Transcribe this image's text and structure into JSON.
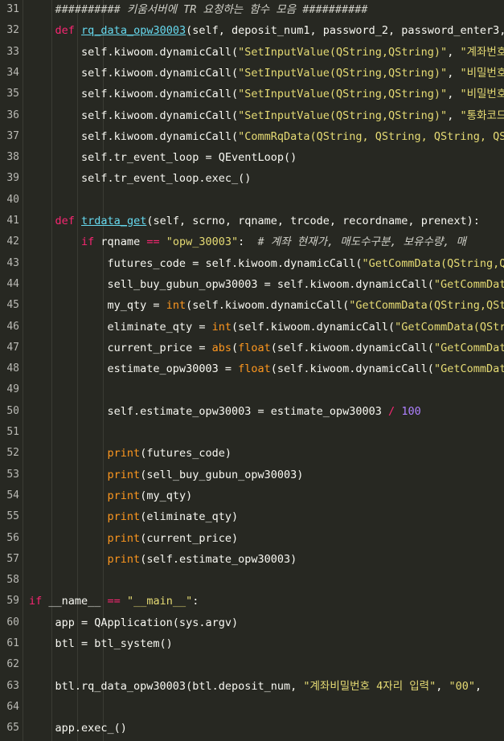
{
  "editor": {
    "lines": [
      {
        "num": "31",
        "tokens": [
          {
            "t": "    "
          },
          {
            "t": "########## 키움서버에 TR 요청하는 함수 모음 ##########",
            "c": "cm"
          }
        ]
      },
      {
        "num": "32",
        "tokens": [
          {
            "t": "    "
          },
          {
            "t": "def",
            "c": "kw"
          },
          {
            "t": " "
          },
          {
            "t": "rq_data_opw30003",
            "c": "fn"
          },
          {
            "t": "(self, deposit_num1, password_2, password_enter3, "
          }
        ]
      },
      {
        "num": "33",
        "tokens": [
          {
            "t": "        self.kiwoom.dynamicCall("
          },
          {
            "t": "\"SetInputValue(QString,QString)\"",
            "c": "str"
          },
          {
            "t": ", "
          },
          {
            "t": "\"계좌번호",
            "c": "str"
          }
        ]
      },
      {
        "num": "34",
        "tokens": [
          {
            "t": "        self.kiwoom.dynamicCall("
          },
          {
            "t": "\"SetInputValue(QString,QString)\"",
            "c": "str"
          },
          {
            "t": ", "
          },
          {
            "t": "\"비밀번호",
            "c": "str"
          }
        ]
      },
      {
        "num": "35",
        "tokens": [
          {
            "t": "        self.kiwoom.dynamicCall("
          },
          {
            "t": "\"SetInputValue(QString,QString)\"",
            "c": "str"
          },
          {
            "t": ", "
          },
          {
            "t": "\"비밀번호",
            "c": "str"
          }
        ]
      },
      {
        "num": "36",
        "tokens": [
          {
            "t": "        self.kiwoom.dynamicCall("
          },
          {
            "t": "\"SetInputValue(QString,QString)\"",
            "c": "str"
          },
          {
            "t": ", "
          },
          {
            "t": "\"통화코드",
            "c": "str"
          }
        ]
      },
      {
        "num": "37",
        "tokens": [
          {
            "t": "        self.kiwoom.dynamicCall("
          },
          {
            "t": "\"CommRqData(QString, QString, QString, QSt",
            "c": "str"
          }
        ]
      },
      {
        "num": "38",
        "tokens": [
          {
            "t": "        self.tr_event_loop = QEventLoop()"
          }
        ]
      },
      {
        "num": "39",
        "tokens": [
          {
            "t": "        self.tr_event_loop.exec_()"
          }
        ]
      },
      {
        "num": "40",
        "tokens": []
      },
      {
        "num": "41",
        "tokens": [
          {
            "t": "    "
          },
          {
            "t": "def",
            "c": "kw"
          },
          {
            "t": " "
          },
          {
            "t": "trdata_get",
            "c": "fn"
          },
          {
            "t": "(self, scrno, rqname, trcode, recordname, prenext):"
          }
        ]
      },
      {
        "num": "42",
        "tokens": [
          {
            "t": "        "
          },
          {
            "t": "if",
            "c": "kw"
          },
          {
            "t": " rqname "
          },
          {
            "t": "==",
            "c": "kw"
          },
          {
            "t": " "
          },
          {
            "t": "\"opw_30003\"",
            "c": "str"
          },
          {
            "t": ":  "
          },
          {
            "t": "# 계좌 현재가, 매도수구분, 보유수량, 매",
            "c": "cm"
          }
        ]
      },
      {
        "num": "43",
        "tokens": [
          {
            "t": "            futures_code = self.kiwoom.dynamicCall("
          },
          {
            "t": "\"GetCommData(QString,QS",
            "c": "str"
          }
        ]
      },
      {
        "num": "44",
        "tokens": [
          {
            "t": "            sell_buy_gubun_opw30003 = self.kiwoom.dynamicCall("
          },
          {
            "t": "\"GetCommData",
            "c": "str"
          }
        ]
      },
      {
        "num": "45",
        "tokens": [
          {
            "t": "            my_qty = "
          },
          {
            "t": "int",
            "c": "bi"
          },
          {
            "t": "(self.kiwoom.dynamicCall("
          },
          {
            "t": "\"GetCommData(QString,QStr",
            "c": "str"
          }
        ]
      },
      {
        "num": "46",
        "tokens": [
          {
            "t": "            eliminate_qty = "
          },
          {
            "t": "int",
            "c": "bi"
          },
          {
            "t": "(self.kiwoom.dynamicCall("
          },
          {
            "t": "\"GetCommData(QStri",
            "c": "str"
          }
        ]
      },
      {
        "num": "47",
        "tokens": [
          {
            "t": "            current_price = "
          },
          {
            "t": "abs",
            "c": "bi"
          },
          {
            "t": "("
          },
          {
            "t": "float",
            "c": "bi"
          },
          {
            "t": "(self.kiwoom.dynamicCall("
          },
          {
            "t": "\"GetCommData",
            "c": "str"
          }
        ]
      },
      {
        "num": "48",
        "tokens": [
          {
            "t": "            estimate_opw30003 = "
          },
          {
            "t": "float",
            "c": "bi"
          },
          {
            "t": "(self.kiwoom.dynamicCall("
          },
          {
            "t": "\"GetCommData",
            "c": "str"
          }
        ]
      },
      {
        "num": "49",
        "tokens": []
      },
      {
        "num": "50",
        "tokens": [
          {
            "t": "            self.estimate_opw30003 = estimate_opw30003 "
          },
          {
            "t": "/",
            "c": "kw"
          },
          {
            "t": " "
          },
          {
            "t": "100",
            "c": "num"
          }
        ]
      },
      {
        "num": "51",
        "tokens": []
      },
      {
        "num": "52",
        "tokens": [
          {
            "t": "            "
          },
          {
            "t": "print",
            "c": "bi"
          },
          {
            "t": "(futures_code)"
          }
        ]
      },
      {
        "num": "53",
        "tokens": [
          {
            "t": "            "
          },
          {
            "t": "print",
            "c": "bi"
          },
          {
            "t": "(sell_buy_gubun_opw30003)"
          }
        ]
      },
      {
        "num": "54",
        "tokens": [
          {
            "t": "            "
          },
          {
            "t": "print",
            "c": "bi"
          },
          {
            "t": "(my_qty)"
          }
        ]
      },
      {
        "num": "55",
        "tokens": [
          {
            "t": "            "
          },
          {
            "t": "print",
            "c": "bi"
          },
          {
            "t": "(eliminate_qty)"
          }
        ]
      },
      {
        "num": "56",
        "tokens": [
          {
            "t": "            "
          },
          {
            "t": "print",
            "c": "bi"
          },
          {
            "t": "(current_price)"
          }
        ]
      },
      {
        "num": "57",
        "tokens": [
          {
            "t": "            "
          },
          {
            "t": "print",
            "c": "bi"
          },
          {
            "t": "(self.estimate_opw30003)"
          }
        ]
      },
      {
        "num": "58",
        "tokens": []
      },
      {
        "num": "59",
        "tokens": [
          {
            "t": "if",
            "c": "kw"
          },
          {
            "t": " __name__ "
          },
          {
            "t": "==",
            "c": "kw"
          },
          {
            "t": " "
          },
          {
            "t": "\"__main__\"",
            "c": "str"
          },
          {
            "t": ":"
          }
        ]
      },
      {
        "num": "60",
        "tokens": [
          {
            "t": "    app = QApplication(sys.argv)"
          }
        ]
      },
      {
        "num": "61",
        "tokens": [
          {
            "t": "    btl = btl_system()"
          }
        ]
      },
      {
        "num": "62",
        "tokens": []
      },
      {
        "num": "63",
        "tokens": [
          {
            "t": "    btl.rq_data_opw30003(btl.deposit_num, "
          },
          {
            "t": "\"계좌비밀번호 4자리 입력\"",
            "c": "str"
          },
          {
            "t": ", "
          },
          {
            "t": "\"00\"",
            "c": "str"
          },
          {
            "t": ","
          }
        ]
      },
      {
        "num": "64",
        "tokens": []
      },
      {
        "num": "65",
        "tokens": [
          {
            "t": "    app.exec_()"
          }
        ]
      }
    ]
  },
  "colors": {
    "background": "#272822",
    "keyword": "#f92672",
    "function": "#66d9ef",
    "string": "#e6db74",
    "number": "#ae81ff",
    "builtin": "#fd971f",
    "comment": "#d0d0c8"
  }
}
